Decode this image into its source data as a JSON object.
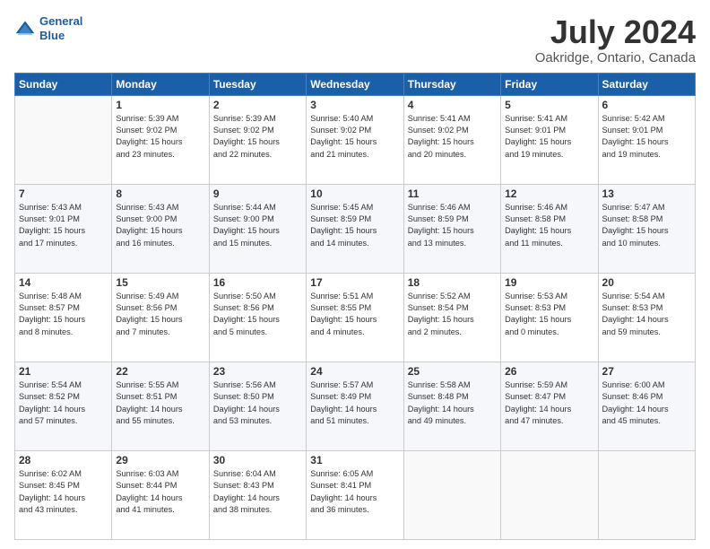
{
  "logo": {
    "line1": "General",
    "line2": "Blue"
  },
  "title": "July 2024",
  "subtitle": "Oakridge, Ontario, Canada",
  "days": [
    "Sunday",
    "Monday",
    "Tuesday",
    "Wednesday",
    "Thursday",
    "Friday",
    "Saturday"
  ],
  "weeks": [
    [
      {
        "num": "",
        "lines": []
      },
      {
        "num": "1",
        "lines": [
          "Sunrise: 5:39 AM",
          "Sunset: 9:02 PM",
          "Daylight: 15 hours",
          "and 23 minutes."
        ]
      },
      {
        "num": "2",
        "lines": [
          "Sunrise: 5:39 AM",
          "Sunset: 9:02 PM",
          "Daylight: 15 hours",
          "and 22 minutes."
        ]
      },
      {
        "num": "3",
        "lines": [
          "Sunrise: 5:40 AM",
          "Sunset: 9:02 PM",
          "Daylight: 15 hours",
          "and 21 minutes."
        ]
      },
      {
        "num": "4",
        "lines": [
          "Sunrise: 5:41 AM",
          "Sunset: 9:02 PM",
          "Daylight: 15 hours",
          "and 20 minutes."
        ]
      },
      {
        "num": "5",
        "lines": [
          "Sunrise: 5:41 AM",
          "Sunset: 9:01 PM",
          "Daylight: 15 hours",
          "and 19 minutes."
        ]
      },
      {
        "num": "6",
        "lines": [
          "Sunrise: 5:42 AM",
          "Sunset: 9:01 PM",
          "Daylight: 15 hours",
          "and 19 minutes."
        ]
      }
    ],
    [
      {
        "num": "7",
        "lines": [
          "Sunrise: 5:43 AM",
          "Sunset: 9:01 PM",
          "Daylight: 15 hours",
          "and 17 minutes."
        ]
      },
      {
        "num": "8",
        "lines": [
          "Sunrise: 5:43 AM",
          "Sunset: 9:00 PM",
          "Daylight: 15 hours",
          "and 16 minutes."
        ]
      },
      {
        "num": "9",
        "lines": [
          "Sunrise: 5:44 AM",
          "Sunset: 9:00 PM",
          "Daylight: 15 hours",
          "and 15 minutes."
        ]
      },
      {
        "num": "10",
        "lines": [
          "Sunrise: 5:45 AM",
          "Sunset: 8:59 PM",
          "Daylight: 15 hours",
          "and 14 minutes."
        ]
      },
      {
        "num": "11",
        "lines": [
          "Sunrise: 5:46 AM",
          "Sunset: 8:59 PM",
          "Daylight: 15 hours",
          "and 13 minutes."
        ]
      },
      {
        "num": "12",
        "lines": [
          "Sunrise: 5:46 AM",
          "Sunset: 8:58 PM",
          "Daylight: 15 hours",
          "and 11 minutes."
        ]
      },
      {
        "num": "13",
        "lines": [
          "Sunrise: 5:47 AM",
          "Sunset: 8:58 PM",
          "Daylight: 15 hours",
          "and 10 minutes."
        ]
      }
    ],
    [
      {
        "num": "14",
        "lines": [
          "Sunrise: 5:48 AM",
          "Sunset: 8:57 PM",
          "Daylight: 15 hours",
          "and 8 minutes."
        ]
      },
      {
        "num": "15",
        "lines": [
          "Sunrise: 5:49 AM",
          "Sunset: 8:56 PM",
          "Daylight: 15 hours",
          "and 7 minutes."
        ]
      },
      {
        "num": "16",
        "lines": [
          "Sunrise: 5:50 AM",
          "Sunset: 8:56 PM",
          "Daylight: 15 hours",
          "and 5 minutes."
        ]
      },
      {
        "num": "17",
        "lines": [
          "Sunrise: 5:51 AM",
          "Sunset: 8:55 PM",
          "Daylight: 15 hours",
          "and 4 minutes."
        ]
      },
      {
        "num": "18",
        "lines": [
          "Sunrise: 5:52 AM",
          "Sunset: 8:54 PM",
          "Daylight: 15 hours",
          "and 2 minutes."
        ]
      },
      {
        "num": "19",
        "lines": [
          "Sunrise: 5:53 AM",
          "Sunset: 8:53 PM",
          "Daylight: 15 hours",
          "and 0 minutes."
        ]
      },
      {
        "num": "20",
        "lines": [
          "Sunrise: 5:54 AM",
          "Sunset: 8:53 PM",
          "Daylight: 14 hours",
          "and 59 minutes."
        ]
      }
    ],
    [
      {
        "num": "21",
        "lines": [
          "Sunrise: 5:54 AM",
          "Sunset: 8:52 PM",
          "Daylight: 14 hours",
          "and 57 minutes."
        ]
      },
      {
        "num": "22",
        "lines": [
          "Sunrise: 5:55 AM",
          "Sunset: 8:51 PM",
          "Daylight: 14 hours",
          "and 55 minutes."
        ]
      },
      {
        "num": "23",
        "lines": [
          "Sunrise: 5:56 AM",
          "Sunset: 8:50 PM",
          "Daylight: 14 hours",
          "and 53 minutes."
        ]
      },
      {
        "num": "24",
        "lines": [
          "Sunrise: 5:57 AM",
          "Sunset: 8:49 PM",
          "Daylight: 14 hours",
          "and 51 minutes."
        ]
      },
      {
        "num": "25",
        "lines": [
          "Sunrise: 5:58 AM",
          "Sunset: 8:48 PM",
          "Daylight: 14 hours",
          "and 49 minutes."
        ]
      },
      {
        "num": "26",
        "lines": [
          "Sunrise: 5:59 AM",
          "Sunset: 8:47 PM",
          "Daylight: 14 hours",
          "and 47 minutes."
        ]
      },
      {
        "num": "27",
        "lines": [
          "Sunrise: 6:00 AM",
          "Sunset: 8:46 PM",
          "Daylight: 14 hours",
          "and 45 minutes."
        ]
      }
    ],
    [
      {
        "num": "28",
        "lines": [
          "Sunrise: 6:02 AM",
          "Sunset: 8:45 PM",
          "Daylight: 14 hours",
          "and 43 minutes."
        ]
      },
      {
        "num": "29",
        "lines": [
          "Sunrise: 6:03 AM",
          "Sunset: 8:44 PM",
          "Daylight: 14 hours",
          "and 41 minutes."
        ]
      },
      {
        "num": "30",
        "lines": [
          "Sunrise: 6:04 AM",
          "Sunset: 8:43 PM",
          "Daylight: 14 hours",
          "and 38 minutes."
        ]
      },
      {
        "num": "31",
        "lines": [
          "Sunrise: 6:05 AM",
          "Sunset: 8:41 PM",
          "Daylight: 14 hours",
          "and 36 minutes."
        ]
      },
      {
        "num": "",
        "lines": []
      },
      {
        "num": "",
        "lines": []
      },
      {
        "num": "",
        "lines": []
      }
    ]
  ]
}
